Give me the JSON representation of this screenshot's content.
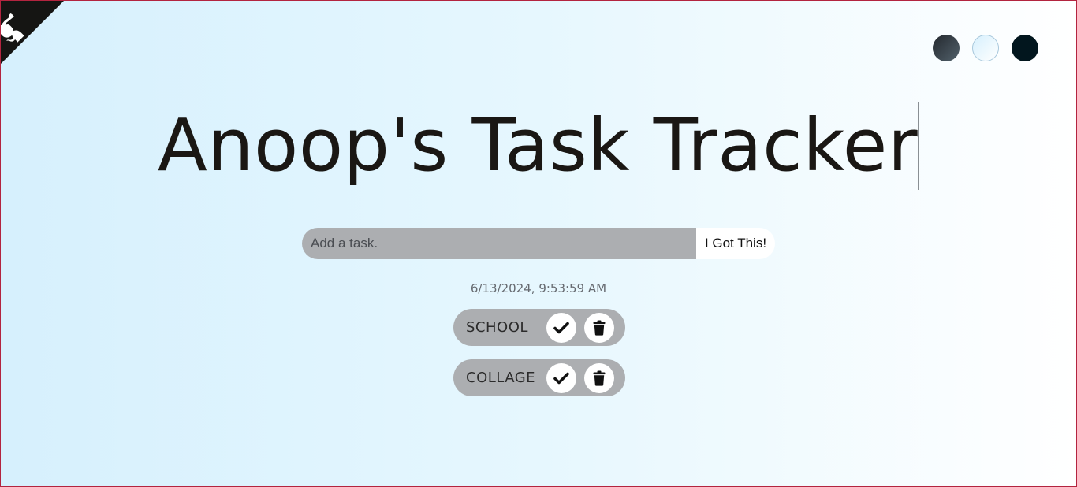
{
  "github": {
    "icon": "octocat-icon",
    "bg_color": "#151513"
  },
  "themes": [
    {
      "name": "standard",
      "color": "#23282e"
    },
    {
      "name": "light",
      "color": "#d6f0fd"
    },
    {
      "name": "darker",
      "color": "#02161e"
    }
  ],
  "header": {
    "title": "Anoop's Task Tracker"
  },
  "form": {
    "input_placeholder": "Add a task.",
    "input_value": "",
    "submit_label": "I Got This!"
  },
  "datetime": "6/13/2024, 9:53:59 AM",
  "tasks": [
    {
      "label": "SCHOOL",
      "check_icon": "check-icon",
      "delete_icon": "trash-icon"
    },
    {
      "label": "COLLAGE",
      "check_icon": "check-icon",
      "delete_icon": "trash-icon"
    }
  ]
}
